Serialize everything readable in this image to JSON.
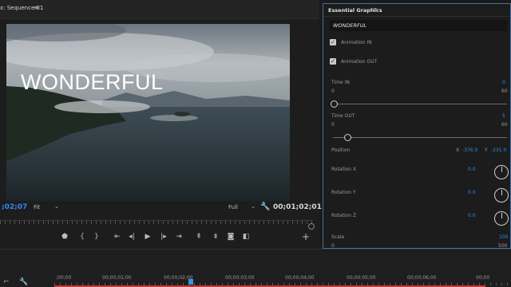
{
  "program_monitor": {
    "tab_title": "x: Sequence 01",
    "menu_icon": "hamburger-icon",
    "overlay_text": "WONDERFUL",
    "timecode_current": ";02;07",
    "fit_option": "Fit",
    "resolution_option": "Full",
    "timecode_duration": "00;01;02;01"
  },
  "transport": {
    "icons": [
      "marker-icon",
      "in-point-icon",
      "out-point-icon",
      "go-to-in-icon",
      "step-back-icon",
      "play-icon",
      "step-forward-icon",
      "go-to-out-icon",
      "lift-icon",
      "extract-icon",
      "export-frame-icon",
      "compare-icon",
      "add-icon"
    ]
  },
  "essential_graphics": {
    "title": "Essential Graphics",
    "text_value": "WONDERFUL",
    "animation_in": {
      "label": "Animation IN",
      "checked": true
    },
    "animation_out": {
      "label": "Animation OUT",
      "checked": true
    },
    "time_in": {
      "label": "Time IN",
      "value": "0",
      "min": "0",
      "max": "60",
      "level": 0
    },
    "time_out": {
      "label": "Time OUT",
      "value": "5",
      "min": "0",
      "max": "60",
      "level": 0.083
    },
    "position": {
      "label": "Position",
      "x_label": "X",
      "x_value": "-376.0",
      "y_label": "Y",
      "y_value": "-231.0"
    },
    "rotation_x": {
      "label": "Rotation X",
      "value": "0.0"
    },
    "rotation_y": {
      "label": "Rotation Y",
      "value": "0.0"
    },
    "rotation_z": {
      "label": "Rotation Z",
      "value": "0.0"
    },
    "scale": {
      "label": "Scale",
      "value": "100",
      "min": "0",
      "max": "500"
    }
  },
  "timeline": {
    "ruler_labels": [
      ";00;00",
      "00;00;01;00",
      "00;00;02;00",
      "00;00;03;00",
      "00;00;04;00",
      "00;00;05;00",
      "00;00;06;00",
      "00;00"
    ],
    "colors": {
      "accent": "#2d8ceb",
      "work_area": "#c23a3a"
    }
  }
}
